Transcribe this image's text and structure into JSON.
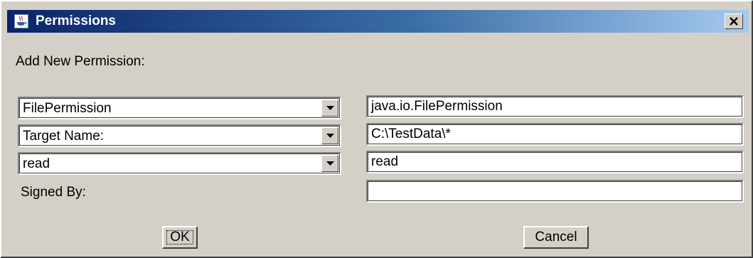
{
  "window": {
    "title": "Permissions",
    "icon": "java-cup-icon",
    "close_label": "x"
  },
  "heading": "Add New Permission:",
  "permission_type": {
    "selected": "FilePermission",
    "class_name": "java.io.FilePermission"
  },
  "target": {
    "selected": "Target Name:",
    "value": "C:\\TestData\\*"
  },
  "actions": {
    "selected": "read",
    "value": "read"
  },
  "signed_by": {
    "label": "Signed By:",
    "value": ""
  },
  "buttons": {
    "ok": "OK",
    "cancel": "Cancel"
  },
  "colors": {
    "dialog_bg": "#d4d0c8",
    "title_gradient_start": "#0a246a",
    "title_gradient_end": "#a6caf0"
  }
}
